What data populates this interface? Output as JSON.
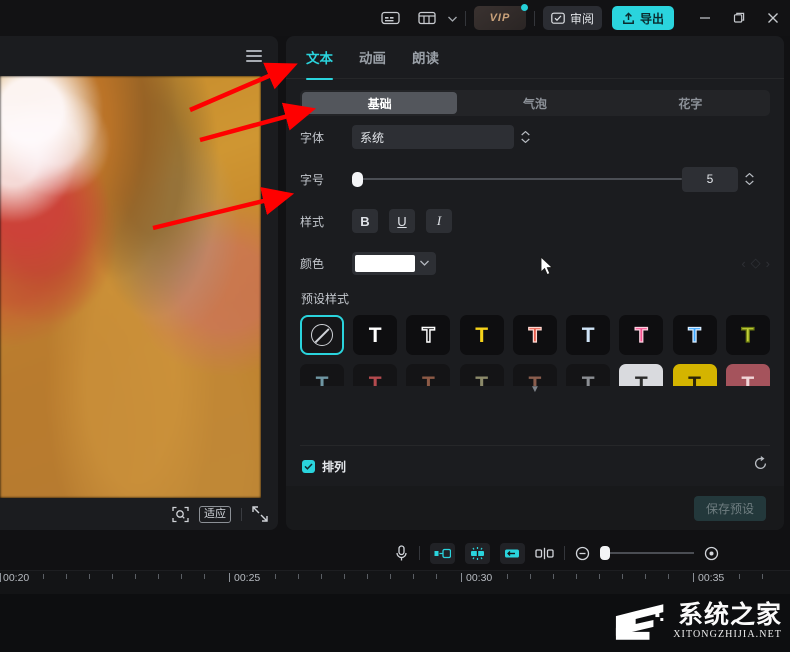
{
  "titlebar": {
    "icons": [
      {
        "name": "subtitle-icon",
        "glyph": "subtitle"
      },
      {
        "name": "keyboard-shortcut-icon",
        "glyph": "keyboard"
      }
    ],
    "vip_label": "VIP",
    "review_label": "审阅",
    "export_label": "导出",
    "minimize_label": "—",
    "maximize_label": "❐",
    "close_label": "✕",
    "accent": "#2ad4dd"
  },
  "preview": {
    "menu_icon": "hamburger-menu-icon",
    "zoom_icon": "zoom-to-selection-icon",
    "fit_label": "适应",
    "fullscreen_icon": "fullscreen-icon"
  },
  "panel": {
    "tabs": [
      {
        "label": "文本",
        "active": true
      },
      {
        "label": "动画",
        "active": false
      },
      {
        "label": "朗读",
        "active": false
      }
    ],
    "segments": [
      {
        "label": "基础",
        "active": true
      },
      {
        "label": "气泡",
        "active": false
      },
      {
        "label": "花字",
        "active": false
      }
    ],
    "font": {
      "label": "字体",
      "value": "系统"
    },
    "fontsize": {
      "label": "字号",
      "value": "5",
      "slider_percent": 0
    },
    "style": {
      "label": "样式",
      "bold": "B",
      "underline": "U",
      "italic": "I"
    },
    "color": {
      "label": "颜色",
      "value": "#ffffff",
      "keyframe_prev": "‹",
      "keyframe_add": "◇",
      "keyframe_next": "›"
    },
    "presets": {
      "label": "预设样式",
      "row1": [
        {
          "name": "none",
          "kind": "none",
          "selected": true
        },
        {
          "name": "white-solid",
          "kind": "T",
          "color": "#ffffff",
          "stroke": ""
        },
        {
          "name": "white-outline",
          "kind": "T",
          "color": "#0e0e10",
          "stroke": "#ffffff"
        },
        {
          "name": "yellow-solid",
          "kind": "T",
          "color": "#f5d21a",
          "stroke": ""
        },
        {
          "name": "red-outline",
          "kind": "T",
          "color": "#e8604f",
          "stroke": "#ffd9d2"
        },
        {
          "name": "lightblue-solid",
          "kind": "T",
          "color": "#cfe4f7",
          "stroke": ""
        },
        {
          "name": "pink-outline",
          "kind": "T",
          "color": "#f5538f",
          "stroke": "#ffd0e2"
        },
        {
          "name": "blue-outline",
          "kind": "T",
          "color": "#3aa6ff",
          "stroke": "#dceeff"
        },
        {
          "name": "olive-outline",
          "kind": "T",
          "color": "#c3d13a",
          "stroke": "#6b7a10"
        }
      ],
      "row2": [
        {
          "name": "teal-shadow",
          "color": "#6f96a3",
          "bg": "#141416"
        },
        {
          "name": "crimson-shadow",
          "color": "#b44a4e",
          "bg": "#141416"
        },
        {
          "name": "brown-shadow",
          "color": "#8d5a46",
          "bg": "#141416"
        },
        {
          "name": "khaki-shadow",
          "color": "#8c8a6a",
          "bg": "#141416"
        },
        {
          "name": "rust-shadow",
          "color": "#8a5d4d",
          "bg": "#141416"
        },
        {
          "name": "gray-shadow",
          "color": "#8b8e93",
          "bg": "#141416"
        },
        {
          "name": "white-plate",
          "color": "#2a2a2a",
          "bg": "#d9dade"
        },
        {
          "name": "gold-plate",
          "color": "#2a2408",
          "bg": "#d4b400"
        },
        {
          "name": "rose-plate",
          "color": "#f0d6d8",
          "bg": "#a5535c"
        }
      ],
      "expand_icon": "chevron-down-icon"
    },
    "arrange": {
      "label": "排列",
      "checked": true,
      "reset_icon": "reset-icon"
    },
    "save_preset_label": "保存预设"
  },
  "timeline": {
    "tools": [
      {
        "name": "record-audio-icon",
        "active": false
      },
      {
        "name": "split-left-icon",
        "active": true
      },
      {
        "name": "auto-cut-icon",
        "active": true
      },
      {
        "name": "split-right-icon",
        "active": true
      },
      {
        "name": "split-icon",
        "active": false
      }
    ],
    "zoom_out_icon": "zoom-out-icon",
    "zoom_in_icon": "zoom-in-icon",
    "zoom_percent": 0,
    "ruler_labels": [
      "00:20",
      "00:25",
      "00:30",
      "00:35"
    ]
  },
  "watermark": {
    "cn": "系统之家",
    "en": "XITONGZHIJIA.NET"
  }
}
